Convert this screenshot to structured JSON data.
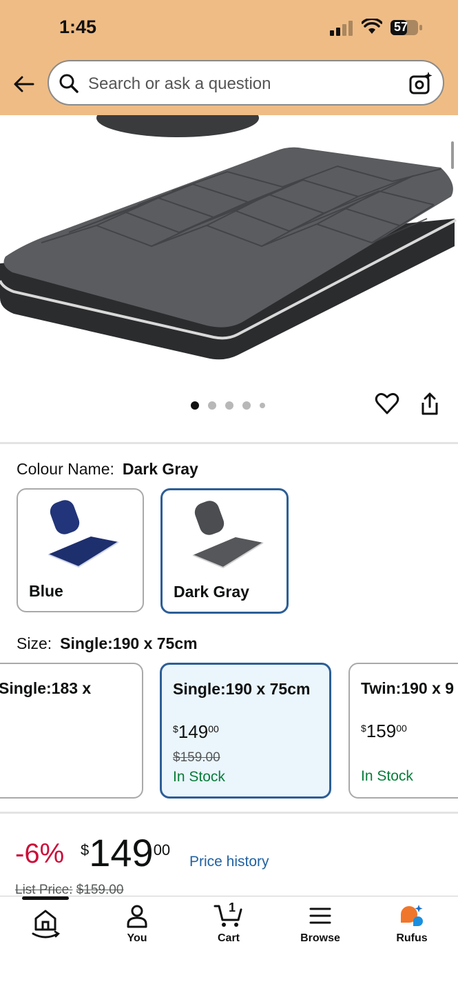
{
  "status_bar": {
    "time": "1:45",
    "battery": "57"
  },
  "header": {
    "search_placeholder": "Search or ask a question"
  },
  "gallery": {
    "image_count": 5,
    "active_index": 0
  },
  "colour": {
    "label": "Colour Name:",
    "selected": "Dark Gray",
    "options": [
      {
        "name": "Blue",
        "color": "#22357a"
      },
      {
        "name": "Dark Gray",
        "color": "#4b4d50"
      }
    ]
  },
  "size": {
    "label": "Size:",
    "selected": "Single:190 x 75cm",
    "options": [
      {
        "title": "Single:183 x",
        "price_whole": "",
        "price_cents": "",
        "list_price": "",
        "stock": ""
      },
      {
        "title": "Single:190 x 75cm",
        "currency": "$",
        "price_whole": "149",
        "price_cents": "00",
        "list_price": "$159.00",
        "stock": "In Stock"
      },
      {
        "title": "Twin:190 x 9",
        "currency": "$",
        "price_whole": "159",
        "price_cents": "00",
        "list_price": "",
        "stock": "In Stock"
      }
    ]
  },
  "pricing": {
    "discount": "-6%",
    "currency": "$",
    "price_whole": "149",
    "price_cents": "00",
    "history_link": "Price history",
    "list_price_label": "List Price:",
    "list_price": "$159.00"
  },
  "nav": {
    "items": [
      {
        "label": "",
        "icon": "home-icon"
      },
      {
        "label": "You",
        "icon": "person-icon"
      },
      {
        "label": "Cart",
        "icon": "cart-icon",
        "badge": "1"
      },
      {
        "label": "Browse",
        "icon": "menu-icon"
      },
      {
        "label": "Rufus",
        "icon": "rufus-icon"
      }
    ]
  },
  "colors": {
    "accent_blue": "#2c5e96",
    "discount_red": "#cc0c39",
    "stock_green": "#067d39",
    "header_bg": "#efbc85"
  }
}
